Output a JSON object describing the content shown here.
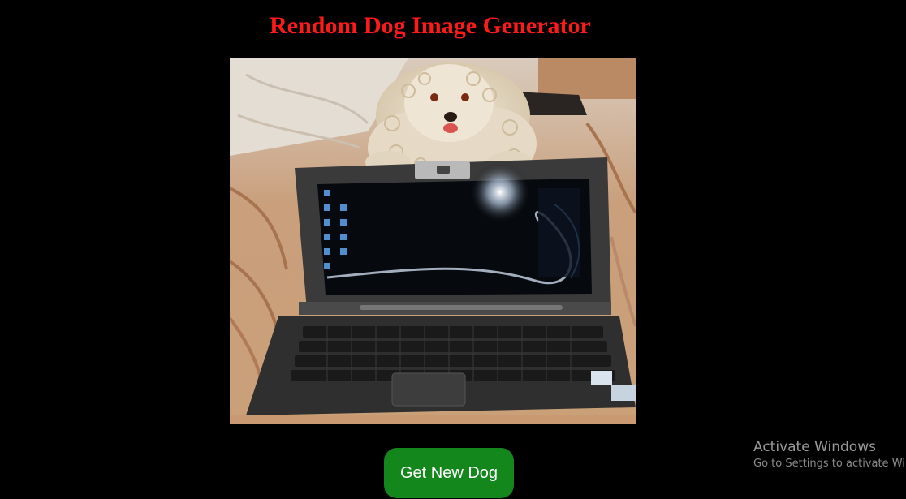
{
  "page": {
    "title": "Rendom Dog Image Generator",
    "button_label": "Get New Dog",
    "image_alt": "Random dog image"
  },
  "watermark": {
    "title": "Activate Windows",
    "subtitle": "Go to Settings to activate Windows."
  },
  "colors": {
    "background": "#000000",
    "title": "#ff1a1a",
    "button": "#13861c",
    "button_text": "#ffffff"
  }
}
